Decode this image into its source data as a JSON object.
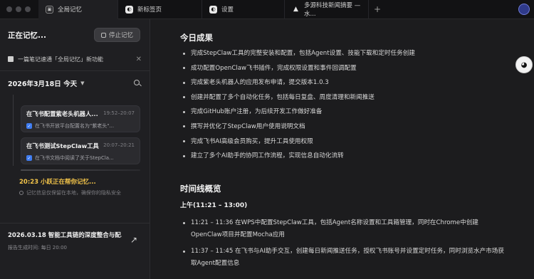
{
  "tabs": [
    {
      "label": "全局记忆",
      "icon": "memory-icon",
      "active": true
    },
    {
      "label": "新标签页",
      "icon": "browser-tab-icon",
      "active": false
    },
    {
      "label": "设置",
      "icon": "settings-tab-icon",
      "active": false
    },
    {
      "label": "多源科技新闻摘要 — 水...",
      "icon": "triangle-logo-icon",
      "active": false
    }
  ],
  "tab_close": "✕",
  "tab_add": "+",
  "sidebar": {
    "title": "正在记忆...",
    "stop_button": "停止记忆",
    "notice": "一篇笔记速通「全局记忆」新功能",
    "date_label": "2026年3月18日 今天",
    "cards": [
      {
        "title": "在飞书配置紫老头机器人...",
        "time": "19:52–20:07",
        "sub": "在飞书开放平台配置名为\"紫老头\"..."
      },
      {
        "title": "在飞书测试StepClaw工具",
        "time": "20:07–20:21",
        "sub": "在飞书文档中阅读了关于StepCla..."
      }
    ],
    "live_title": "20:23 小跃正在帮你记忆...",
    "live_sub": "记忆信息仅保留在本地，确保你的隐私安全",
    "report_title": "2026.03.18 智能工具链的深度整合与配...",
    "report_sub": "报告生成时间: 每日 20:00",
    "report_time_chevron": "›"
  },
  "main": {
    "today_heading": "今日成果",
    "today_items": [
      "完成StepClaw工具的完整安装和配置，包括Agent设置、技能下载和定时任务创建",
      "成功配置OpenClaw飞书插件，完成权限设置和事件回调配置",
      "完成紫老头机器人的应用发布申请，提交版本1.0.3",
      "创建并配置了多个自动化任务，包括每日复盘、周度清理和新闻推送",
      "完成GitHub账户注册，为后续开发工作做好准备",
      "撰写并优化了StepClaw用户使用说明文档",
      "完成飞书AI高级会员购买，提升工具使用权限",
      "建立了多个AI助手的协同工作流程，实现信息自动化流转"
    ],
    "timeline_heading": "时间线概览",
    "morning_label": "上午(11:21 – 13:00)",
    "timeline_items": [
      "11:21 – 11:36 在WPS中配置StepClaw工具，包括Agent名称设置和工具箱管理，同时在Chrome中创建OpenClaw项目并配置Mocha应用",
      "11:37 – 11:45 在飞书与AI助手交互，创建每日新闻推送任务，授权飞书账号并设置定时任务，同时浏览水产市场获取Agent配置信息"
    ]
  }
}
